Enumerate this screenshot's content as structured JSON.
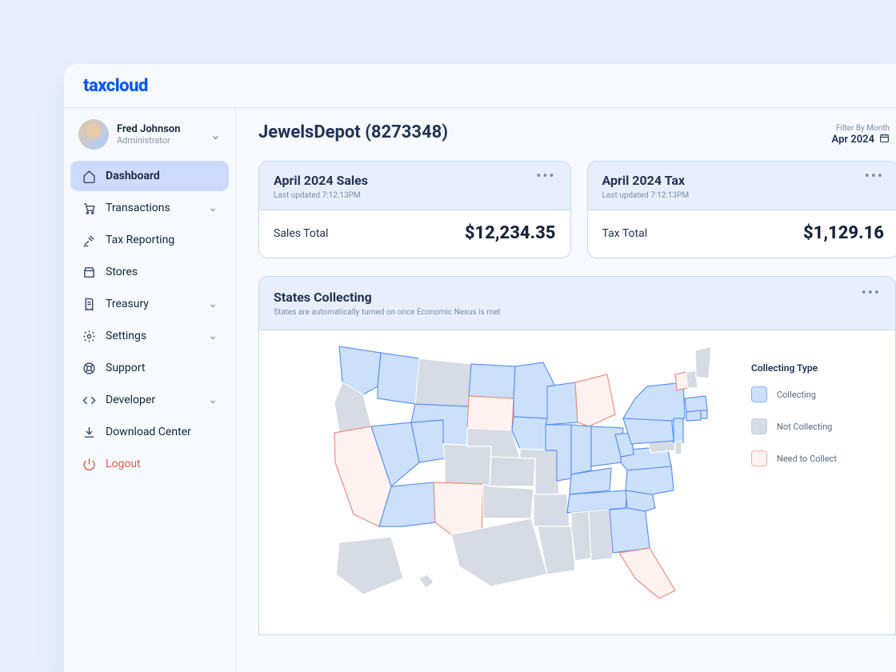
{
  "brand": "taxcloud",
  "profile": {
    "name": "Fred Johnson",
    "role": "Administrator"
  },
  "nav": {
    "items": [
      {
        "label": "Dashboard",
        "icon": "home",
        "chevron": false,
        "active": true
      },
      {
        "label": "Transactions",
        "icon": "cart",
        "chevron": true
      },
      {
        "label": "Tax Reporting",
        "icon": "gavel",
        "chevron": false
      },
      {
        "label": "Stores",
        "icon": "store",
        "chevron": false
      },
      {
        "label": "Treasury",
        "icon": "receipt",
        "chevron": true
      },
      {
        "label": "Settings",
        "icon": "gear",
        "chevron": true
      },
      {
        "label": "Support",
        "icon": "lifebuoy",
        "chevron": false
      },
      {
        "label": "Developer",
        "icon": "code",
        "chevron": true
      },
      {
        "label": "Download Center",
        "icon": "download",
        "chevron": false
      },
      {
        "label": "Logout",
        "icon": "power",
        "chevron": false,
        "logout": true
      }
    ]
  },
  "page": {
    "title": "JewelsDepot (8273348)",
    "filter_label": "Filter By Month",
    "filter_value": "Apr 2024"
  },
  "cards": {
    "sales": {
      "title": "April 2024 Sales",
      "updated": "Last updated 7:12:13PM",
      "metric_label": "Sales Total",
      "metric_value": "$12,234.35"
    },
    "tax": {
      "title": "April 2024 Tax",
      "updated": "Last updated 7:12:13PM",
      "metric_label": "Tax Total",
      "metric_value": "$1,129.16"
    }
  },
  "states_card": {
    "title": "States Collecting",
    "subtitle": "States are automatically turned on once Economic Nexus is met",
    "legend_title": "Collecting Type",
    "legend": {
      "collecting": "Collecting",
      "not_collecting": "Not Collecting",
      "need": "Need to Collect"
    },
    "state_status": {
      "collecting": [
        "WA",
        "ID",
        "NV",
        "UT",
        "AZ",
        "WY",
        "ND",
        "MN",
        "WI",
        "IA",
        "IL",
        "IN",
        "OH",
        "KY",
        "TN",
        "WV",
        "VA",
        "NC",
        "SC",
        "GA",
        "PA",
        "NY",
        "NJ",
        "CT",
        "RI",
        "MA"
      ],
      "need_to_collect": [
        "CA",
        "NM",
        "SD",
        "MI",
        "VT",
        "FL"
      ],
      "not_collecting": [
        "OR",
        "MT",
        "CO",
        "NE",
        "KS",
        "OK",
        "TX",
        "MO",
        "AR",
        "LA",
        "MS",
        "AL",
        "ME",
        "NH",
        "MD",
        "DE",
        "AK",
        "HI"
      ]
    }
  }
}
